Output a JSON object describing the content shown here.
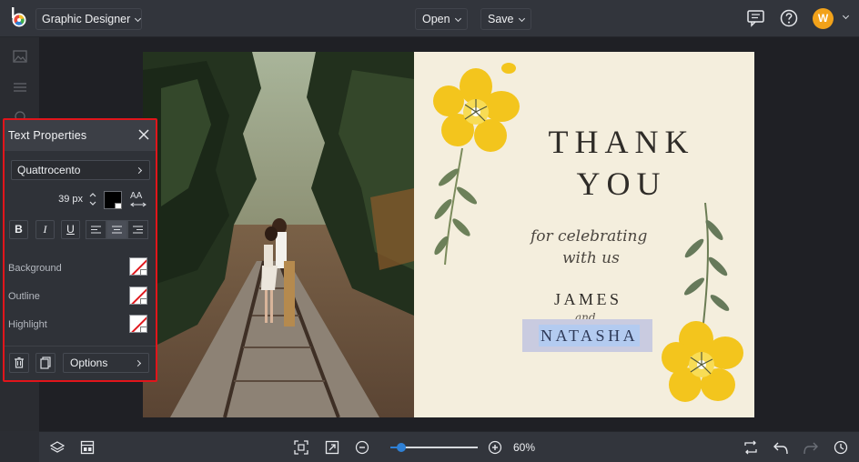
{
  "app": {
    "mode_label": "Graphic Designer",
    "menu_open": "Open",
    "menu_save": "Save",
    "user_initial": "W",
    "accent": "#f2a21a"
  },
  "text_properties": {
    "title": "Text Properties",
    "font": "Quattrocento",
    "size": "39 px",
    "text_color": "#000000",
    "aa_label": "AA",
    "bold_label": "B",
    "italic_label": "I",
    "underline_label": "U",
    "alignment": "center",
    "background_label": "Background",
    "outline_label": "Outline",
    "highlight_label": "Highlight",
    "options_label": "Options",
    "panel_border_color": "#e1151b"
  },
  "card": {
    "thank": "THANK",
    "you": "YOU",
    "for_celebrating": "for celebrating",
    "with_us": "with us",
    "name1": "JAMES",
    "and": "and",
    "name2": "NATASHA",
    "background": "#f4eedd"
  },
  "zoom": {
    "value": 0.6,
    "label": "60%"
  },
  "icons": [
    "logo-icon",
    "comment-icon",
    "help-icon",
    "layers-icon",
    "templates-icon",
    "fit-screen-icon",
    "expand-icon",
    "zoom-out-icon",
    "zoom-in-icon",
    "swap-icon",
    "undo-icon",
    "redo-icon",
    "history-icon",
    "trash-icon",
    "duplicate-icon",
    "close-icon"
  ]
}
